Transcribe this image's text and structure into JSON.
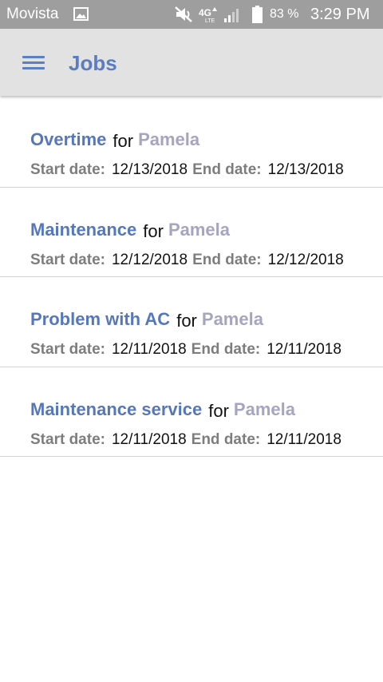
{
  "status_bar": {
    "carrier": "Movista",
    "battery": "83 %",
    "time": "3:29 PM",
    "icons": [
      "gallery-icon",
      "mute-icon",
      "lte-icon",
      "signal-icon",
      "battery-icon"
    ]
  },
  "app_bar": {
    "title": "Jobs",
    "menu_icon": "hamburger-menu-icon"
  },
  "jobs": [
    {
      "name": "Overtime",
      "for": "for",
      "person": "Pamela",
      "start_label": "Start date:",
      "start": "12/13/2018",
      "end_label": "End date:",
      "end": "12/13/2018"
    },
    {
      "name": "Maintenance",
      "for": "for",
      "person": "Pamela",
      "start_label": "Start date:",
      "start": "12/12/2018",
      "end_label": "End date:",
      "end": "12/12/2018"
    },
    {
      "name": "Problem with AC",
      "for": "for",
      "person": "Pamela",
      "start_label": "Start date:",
      "start": "12/11/2018",
      "end_label": "End date:",
      "end": "12/11/2018"
    },
    {
      "name": "Maintenance service",
      "for": "for",
      "person": "Pamela",
      "start_label": "Start date:",
      "start": "12/11/2018",
      "end_label": "End date:",
      "end": "12/11/2018"
    }
  ],
  "colors": {
    "status_bar": "#9e9e9e",
    "app_bar": "#e2e2e2",
    "accent": "#5b7cc0",
    "person": "#a7a4c0",
    "label": "#7d7d7d"
  }
}
